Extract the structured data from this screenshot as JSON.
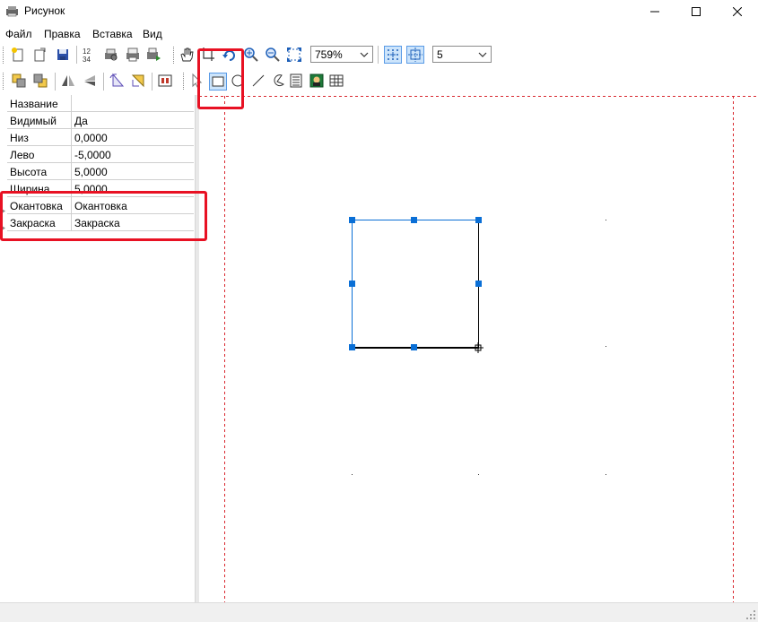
{
  "window": {
    "title": "Рисунок",
    "controls": {
      "minimize": "—",
      "maximize": "☐",
      "close": "✕"
    }
  },
  "menu": {
    "items": [
      "Файл",
      "Правка",
      "Вставка",
      "Вид"
    ]
  },
  "toolbar": {
    "zoom_value": "759%",
    "grid_value": "5",
    "icons": [
      "new-icon",
      "open-icon",
      "save-icon",
      "numbering-icon",
      "print-preview-icon",
      "print-icon",
      "export-icon",
      "pan-hand-icon",
      "crop-icon",
      "rotate-icon",
      "zoom-in-icon",
      "zoom-out-icon",
      "fit-icon",
      "snap-grid-icon",
      "snap-object-icon"
    ]
  },
  "drawing_tools": {
    "icons": [
      "bring-front-icon",
      "send-back-icon",
      "flip-horizontal-icon",
      "flip-vertical-icon",
      "rotate-left-icon",
      "rotate-right-icon",
      "align-icon",
      "select-icon",
      "rectangle-icon",
      "ellipse-icon",
      "line-icon",
      "arc-icon",
      "text-icon",
      "image-icon",
      "table-icon"
    ],
    "active": "rectangle-icon"
  },
  "properties": {
    "rows": [
      {
        "name": "Название",
        "value": ""
      },
      {
        "name": "Видимый",
        "value": "Да"
      },
      {
        "name": "Низ",
        "value": "0,0000"
      },
      {
        "name": "Лево",
        "value": "-5,0000"
      },
      {
        "name": "Высота",
        "value": "5,0000"
      },
      {
        "name": "Ширина",
        "value": "5,0000"
      },
      {
        "name": "Окантовка",
        "value": "Окантовка"
      },
      {
        "name": "Закраска",
        "value": "Закраска"
      }
    ]
  },
  "colors": {
    "selection_blue": "#0a6fd6",
    "page_border_red": "#d9272e",
    "highlight_red": "#e81123"
  }
}
